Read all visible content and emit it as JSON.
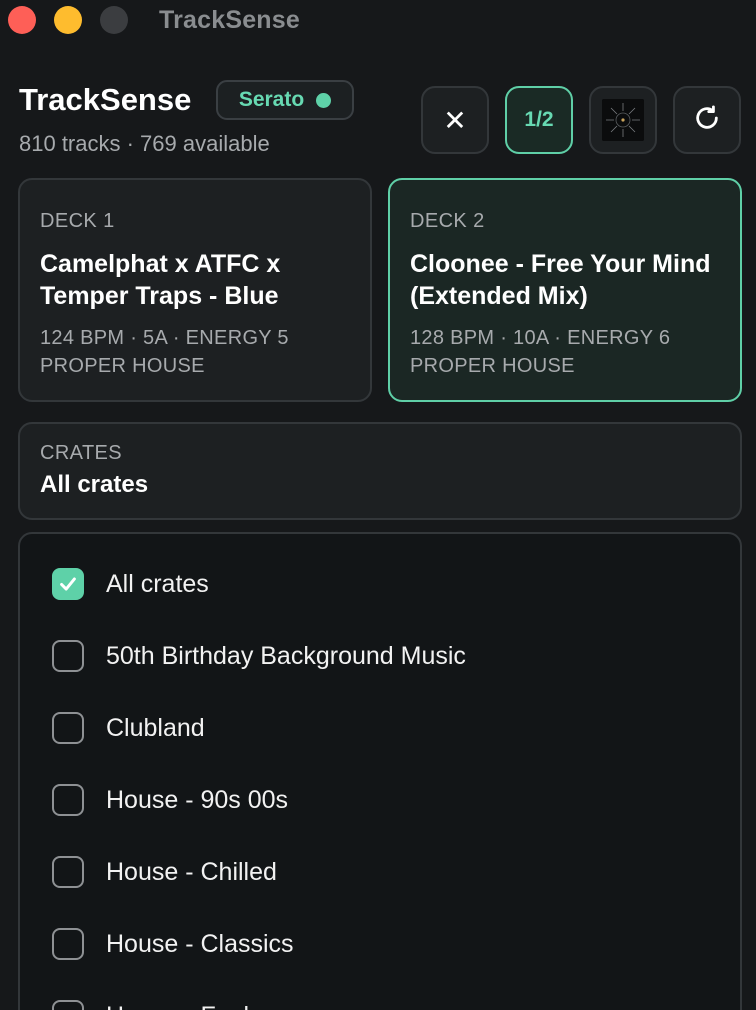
{
  "window": {
    "title": "TrackSense"
  },
  "header": {
    "app_title": "TrackSense",
    "source_badge": "Serato",
    "source_status_color": "#5ed1a8",
    "track_count": "810 tracks · 769 available"
  },
  "toolbar": {
    "close_icon": "close-icon",
    "deck_toggle_label": "1/2",
    "artwork_icon": "album-artwork-thumbnail",
    "refresh_icon": "refresh-icon"
  },
  "decks": [
    {
      "label": "DECK 1",
      "track": "Camelphat x ATFC x Temper Traps - Blue",
      "meta": "124 BPM · 5A · ENERGY 5",
      "crate": "PROPER HOUSE",
      "active": false
    },
    {
      "label": "DECK 2",
      "track": "Cloonee - Free Your Mind (Extended Mix)",
      "meta": "128 BPM · 10A · ENERGY 6",
      "crate": "PROPER HOUSE",
      "active": true
    }
  ],
  "crates": {
    "label": "CRATES",
    "selected": "All crates",
    "items": [
      {
        "name": "All crates",
        "checked": true
      },
      {
        "name": "50th Birthday Background Music",
        "checked": false
      },
      {
        "name": "Clubland",
        "checked": false
      },
      {
        "name": "House - 90s 00s",
        "checked": false
      },
      {
        "name": "House - Chilled",
        "checked": false
      },
      {
        "name": "House - Classics",
        "checked": false
      },
      {
        "name": "House - Funky",
        "checked": false
      }
    ]
  },
  "colors": {
    "accent": "#5ed1a8",
    "background": "#16181a",
    "card": "#1d2022"
  }
}
